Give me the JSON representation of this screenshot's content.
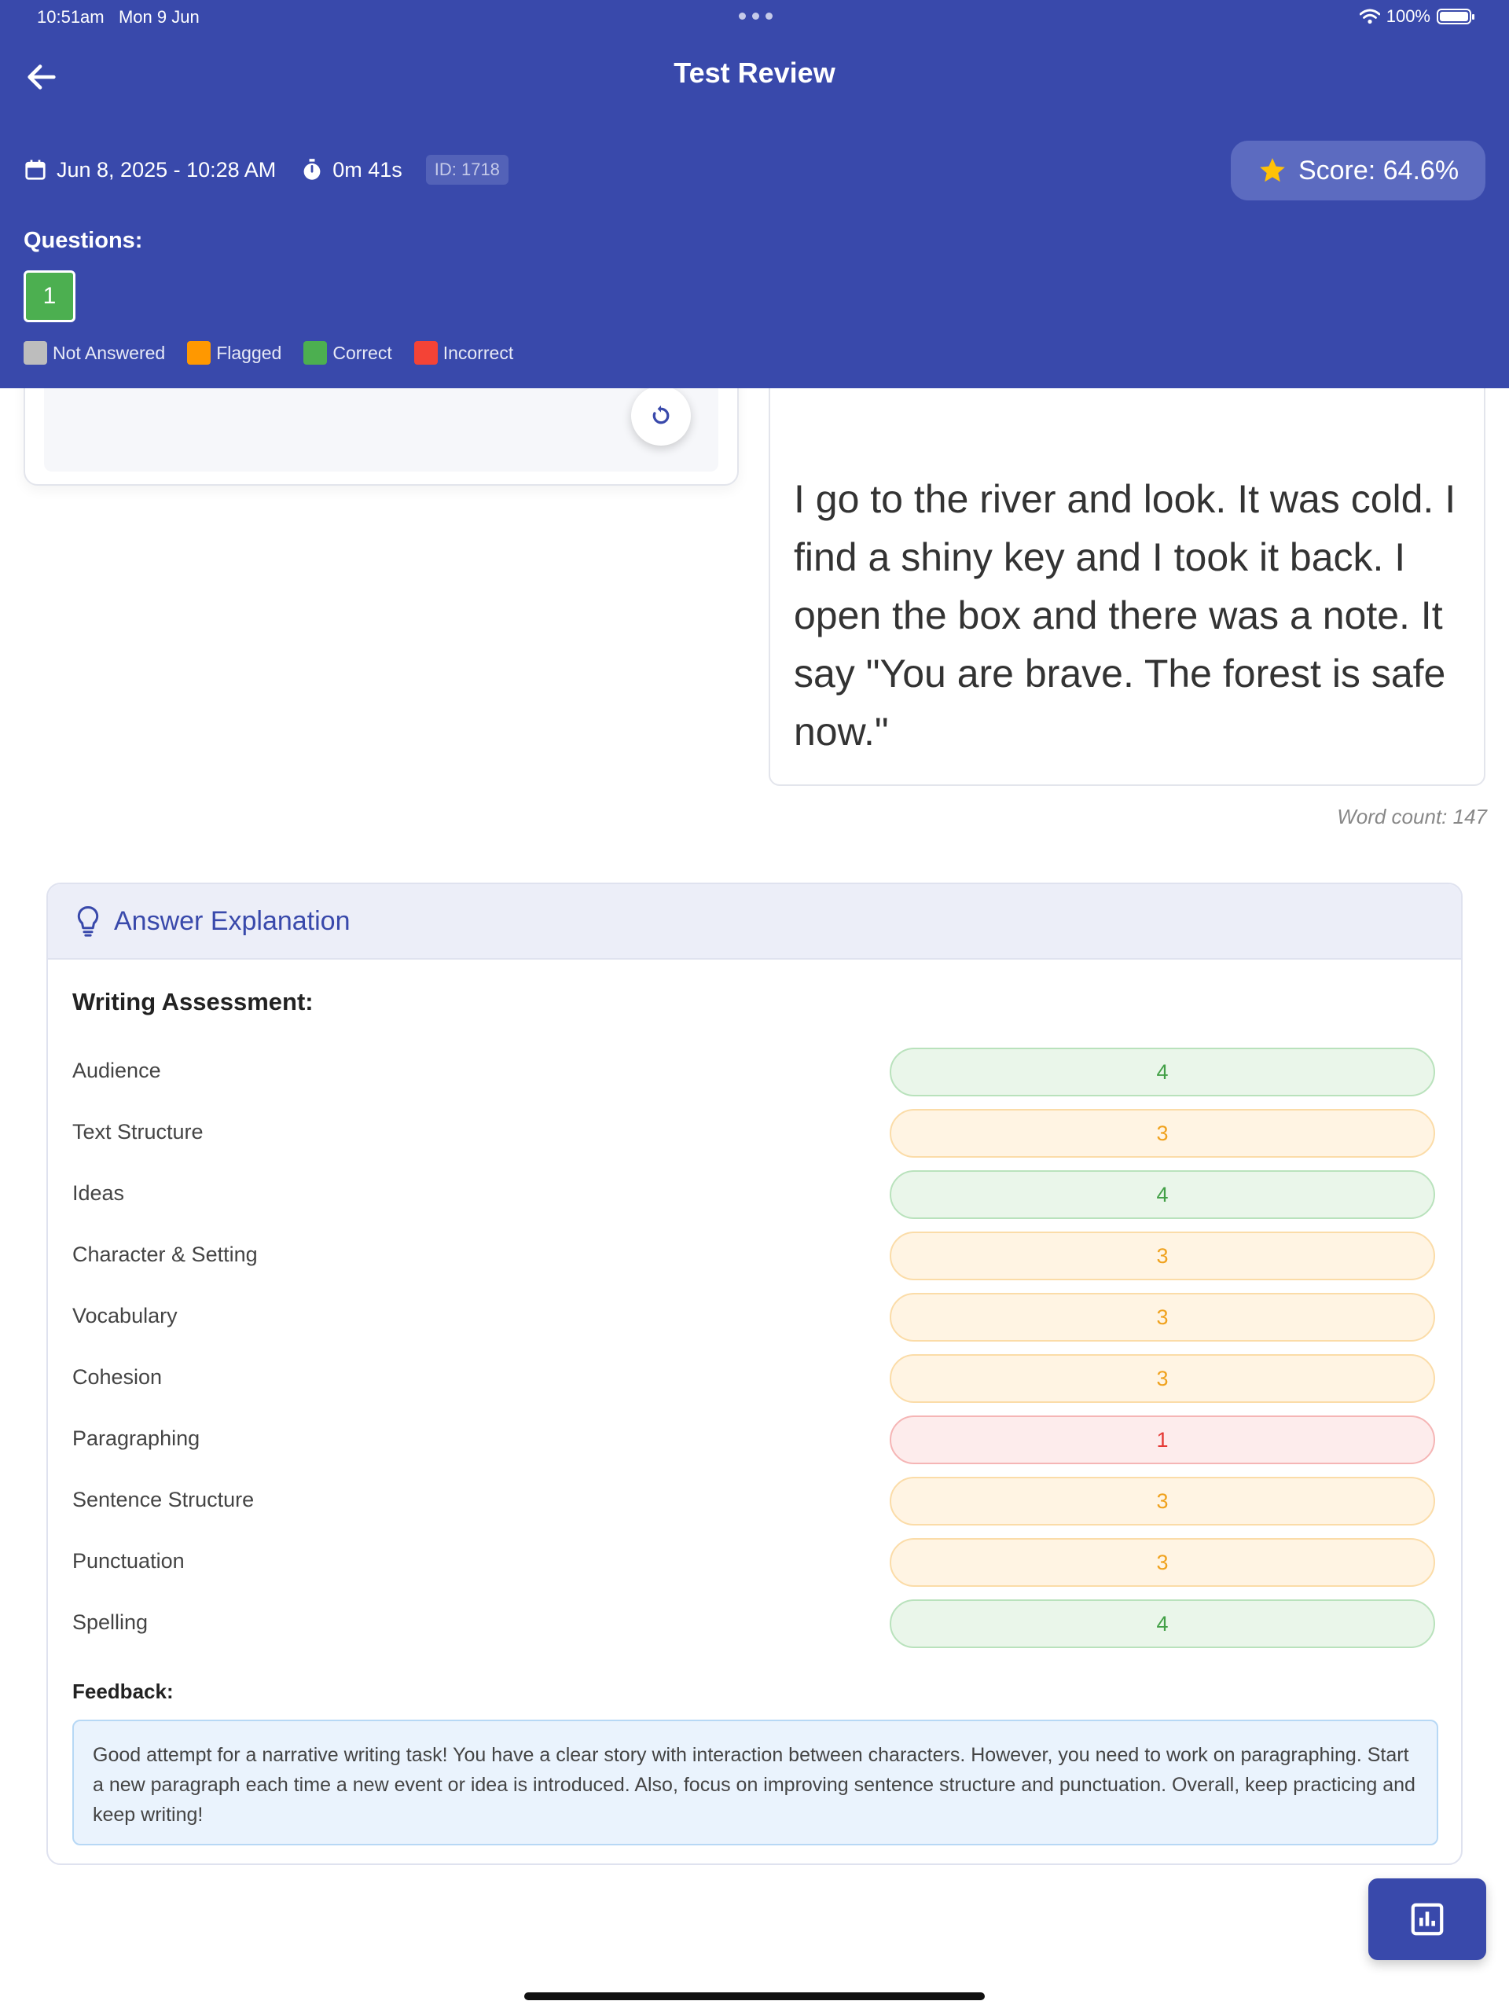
{
  "status_bar": {
    "time": "10:51am",
    "date": "Mon 9 Jun",
    "battery": "100%"
  },
  "header": {
    "title": "Test Review",
    "datetime": "Jun 8, 2025 - 10:28 AM",
    "duration": "0m 41s",
    "test_id": "ID: 1718",
    "score": "Score: 64.6%"
  },
  "questions": {
    "label": "Questions:",
    "items": [
      {
        "number": "1",
        "status": "correct"
      }
    ]
  },
  "legend": {
    "items": [
      {
        "label": "Not Answered",
        "color": "#BDBDBD"
      },
      {
        "label": "Flagged",
        "color": "#FF9800"
      },
      {
        "label": "Correct",
        "color": "#4CAF50"
      },
      {
        "label": "Incorrect",
        "color": "#F44336"
      }
    ]
  },
  "answer": {
    "text": "I go to the river and look. It was cold. I find a shiny key and I took it back. I open the box and there was a note. It say \"You are brave. The forest is safe now.\"",
    "word_count": "Word count: 147"
  },
  "explanation": {
    "title": "Answer Explanation",
    "assessment_title": "Writing Assessment:",
    "criteria": [
      {
        "label": "Audience",
        "score": "4",
        "level": "green"
      },
      {
        "label": "Text Structure",
        "score": "3",
        "level": "orange"
      },
      {
        "label": "Ideas",
        "score": "4",
        "level": "green"
      },
      {
        "label": "Character & Setting",
        "score": "3",
        "level": "orange"
      },
      {
        "label": "Vocabulary",
        "score": "3",
        "level": "orange"
      },
      {
        "label": "Cohesion",
        "score": "3",
        "level": "orange"
      },
      {
        "label": "Paragraphing",
        "score": "1",
        "level": "red"
      },
      {
        "label": "Sentence Structure",
        "score": "3",
        "level": "orange"
      },
      {
        "label": "Punctuation",
        "score": "3",
        "level": "orange"
      },
      {
        "label": "Spelling",
        "score": "4",
        "level": "green"
      }
    ],
    "feedback_label": "Feedback:",
    "feedback": "Good attempt for a narrative writing task! You have a clear story with interaction between characters. However, you need to work on paragraphing. Start a new paragraph each time a new event or idea is introduced. Also, focus on improving sentence structure and punctuation. Overall, keep practicing and keep writing!"
  },
  "colors": {
    "primary": "#3949AB",
    "score_star": "#FFC107"
  }
}
